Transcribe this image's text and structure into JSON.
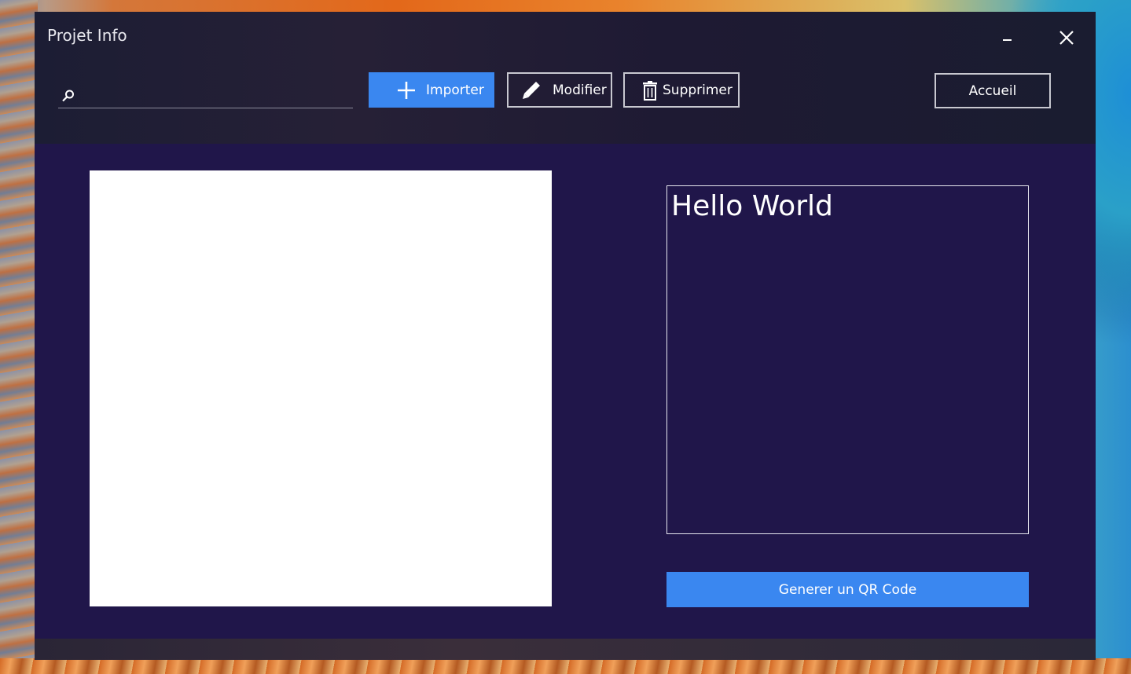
{
  "window": {
    "title": "Projet Info"
  },
  "title_bar": {
    "minimize_icon": "minimize-icon",
    "close_icon": "close-icon"
  },
  "search": {
    "icon": "search-icon",
    "value": "",
    "placeholder": ""
  },
  "toolbar": {
    "import_label": "Importer",
    "import_icon": "plus-icon",
    "modify_label": "Modifier",
    "modify_icon": "pencil-icon",
    "delete_label": "Supprimer",
    "delete_icon": "trash-icon",
    "home_label": "Accueil"
  },
  "main": {
    "text_value": "Hello World",
    "generate_label": "Generer un QR Code"
  },
  "colors": {
    "accent": "#3a87f0",
    "background": "#20164a",
    "header": "#1c1d34"
  }
}
